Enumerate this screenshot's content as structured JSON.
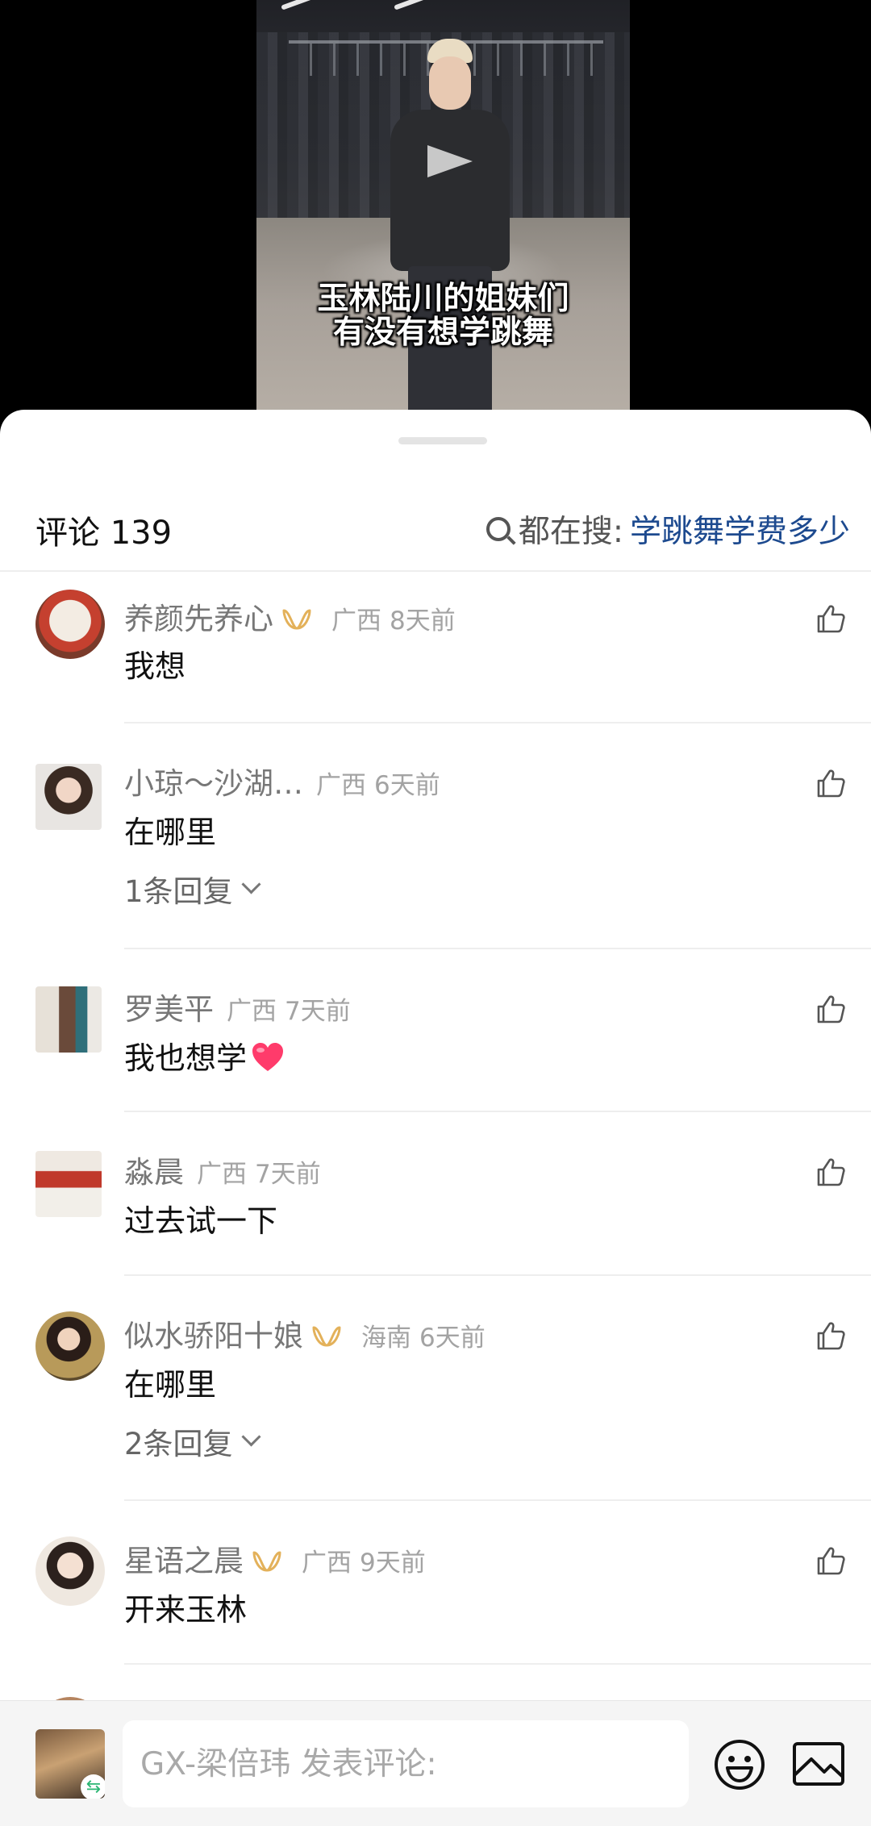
{
  "video": {
    "caption_line1": "玉林陆川的姐妹们",
    "caption_line2": "有没有想学跳舞"
  },
  "header": {
    "title": "评论 139",
    "search_prefix": "都在搜:",
    "search_keyword": "学跳舞学费多少"
  },
  "comments": [
    {
      "author": "养颜先养心",
      "region": "广西",
      "time": "8天前",
      "text": "我想",
      "replies": ""
    },
    {
      "author": "小琼～沙湖…",
      "region": "广西",
      "time": "6天前",
      "text": "在哪里",
      "replies": "1条回复"
    },
    {
      "author": "罗美平",
      "region": "广西",
      "time": "7天前",
      "text": "我也想学",
      "replies": ""
    },
    {
      "author": "淼晨",
      "region": "广西",
      "time": "7天前",
      "text": "过去试一下",
      "replies": ""
    },
    {
      "author": "似水骄阳十娘",
      "region": "海南",
      "time": "6天前",
      "text": "在哪里",
      "replies": "2条回复"
    },
    {
      "author": "星语之晨",
      "region": "广西",
      "time": "9天前",
      "text": "开来玉林",
      "replies": ""
    }
  ],
  "composer": {
    "placeholder": "GX-梁倍玮 发表评论:"
  },
  "colors": {
    "search_keyword": "#1d4a8f",
    "vip_badge": "#e3b15a",
    "heart": "#ff3b6b"
  }
}
